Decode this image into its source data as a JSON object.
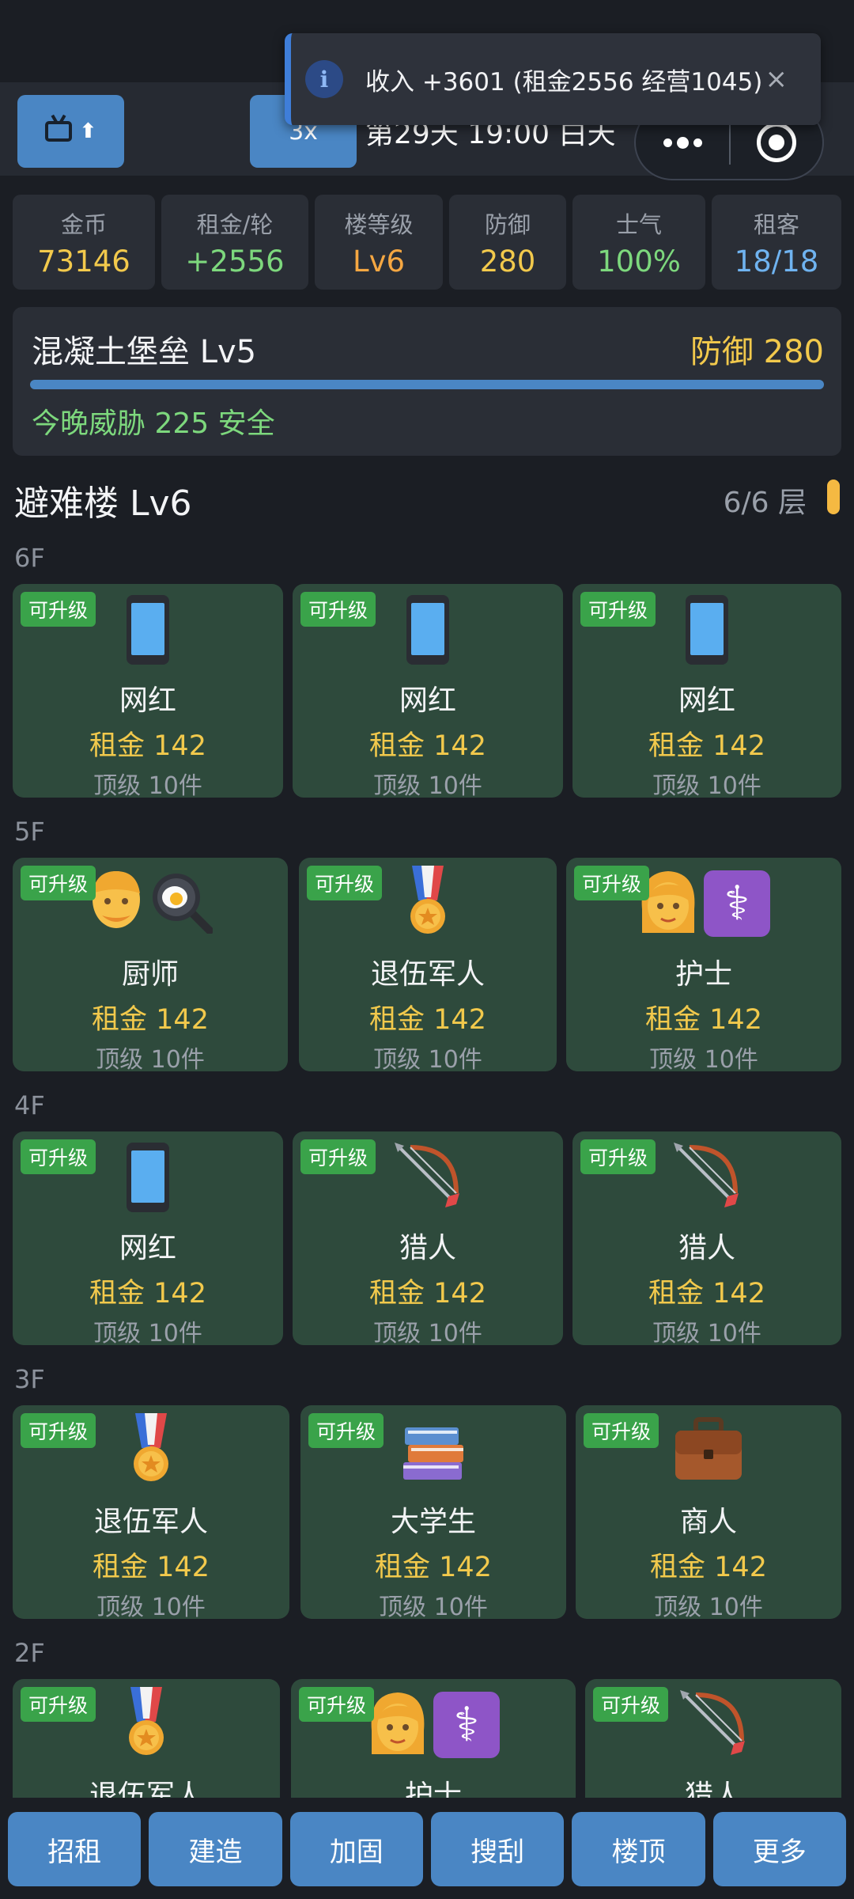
{
  "toast": {
    "message": "收入 +3601 (租金2556 经营1045)",
    "close": "×",
    "info_glyph": "i"
  },
  "topbar": {
    "speed_label": "3x",
    "day_text": "第29天 19:00 白天",
    "tv_arrow": "⬆"
  },
  "stats": [
    {
      "label": "金币",
      "value": "73146",
      "color": "#f2c94c"
    },
    {
      "label": "租金/轮",
      "value": "+2556",
      "color": "#7dd87d"
    },
    {
      "label": "楼等级",
      "value": "Lv6",
      "color": "#f5a742"
    },
    {
      "label": "防御",
      "value": "280",
      "color": "#f2c94c"
    },
    {
      "label": "士气",
      "value": "100%",
      "color": "#7dd87d"
    },
    {
      "label": "租客",
      "value": "18/18",
      "color": "#6fb3f0"
    }
  ],
  "fortress": {
    "name": "混凝土堡垒 Lv5",
    "defense": "防御 280",
    "threat": "今晚威胁 225 安全"
  },
  "building": {
    "title": "避难楼 Lv6",
    "floors": "6/6 层"
  },
  "floors": [
    {
      "label": "6F",
      "rooms": [
        {
          "badge": "可升级",
          "icons": [
            "phone-icon"
          ],
          "name": "网红",
          "rent": "租金 142",
          "top": "顶级 10件"
        },
        {
          "badge": "可升级",
          "icons": [
            "phone-icon"
          ],
          "name": "网红",
          "rent": "租金 142",
          "top": "顶级 10件"
        },
        {
          "badge": "可升级",
          "icons": [
            "phone-icon"
          ],
          "name": "网红",
          "rent": "租金 142",
          "top": "顶级 10件"
        }
      ]
    },
    {
      "label": "5F",
      "rooms": [
        {
          "badge": "可升级",
          "icons": [
            "cook-face-icon",
            "frying-pan-icon"
          ],
          "name": "厨师",
          "rent": "租金 142",
          "top": "顶级 10件"
        },
        {
          "badge": "可升级",
          "icons": [
            "medal-icon"
          ],
          "name": "退伍军人",
          "rent": "租金 142",
          "top": "顶级 10件"
        },
        {
          "badge": "可升级",
          "icons": [
            "woman-face-icon",
            "caduceus-icon"
          ],
          "name": "护士",
          "rent": "租金 142",
          "top": "顶级 10件"
        }
      ]
    },
    {
      "label": "4F",
      "rooms": [
        {
          "badge": "可升级",
          "icons": [
            "phone-icon"
          ],
          "name": "网红",
          "rent": "租金 142",
          "top": "顶级 10件"
        },
        {
          "badge": "可升级",
          "icons": [
            "bow-arrow-icon"
          ],
          "name": "猎人",
          "rent": "租金 142",
          "top": "顶级 10件"
        },
        {
          "badge": "可升级",
          "icons": [
            "bow-arrow-icon"
          ],
          "name": "猎人",
          "rent": "租金 142",
          "top": "顶级 10件"
        }
      ]
    },
    {
      "label": "3F",
      "rooms": [
        {
          "badge": "可升级",
          "icons": [
            "medal-icon"
          ],
          "name": "退伍军人",
          "rent": "租金 142",
          "top": "顶级 10件"
        },
        {
          "badge": "可升级",
          "icons": [
            "books-icon"
          ],
          "name": "大学生",
          "rent": "租金 142",
          "top": "顶级 10件"
        },
        {
          "badge": "可升级",
          "icons": [
            "briefcase-icon"
          ],
          "name": "商人",
          "rent": "租金 142",
          "top": "顶级 10件"
        }
      ]
    },
    {
      "label": "2F",
      "rooms": [
        {
          "badge": "可升级",
          "icons": [
            "medal-icon"
          ],
          "name": "退伍军人",
          "rent": "",
          "top": ""
        },
        {
          "badge": "可升级",
          "icons": [
            "woman-face-icon",
            "caduceus-icon"
          ],
          "name": "护士",
          "rent": "",
          "top": ""
        },
        {
          "badge": "可升级",
          "icons": [
            "bow-arrow-icon"
          ],
          "name": "猎人",
          "rent": "",
          "top": ""
        }
      ]
    }
  ],
  "bottom_nav": [
    "招租",
    "建造",
    "加固",
    "搜刮",
    "楼顶",
    "更多"
  ]
}
